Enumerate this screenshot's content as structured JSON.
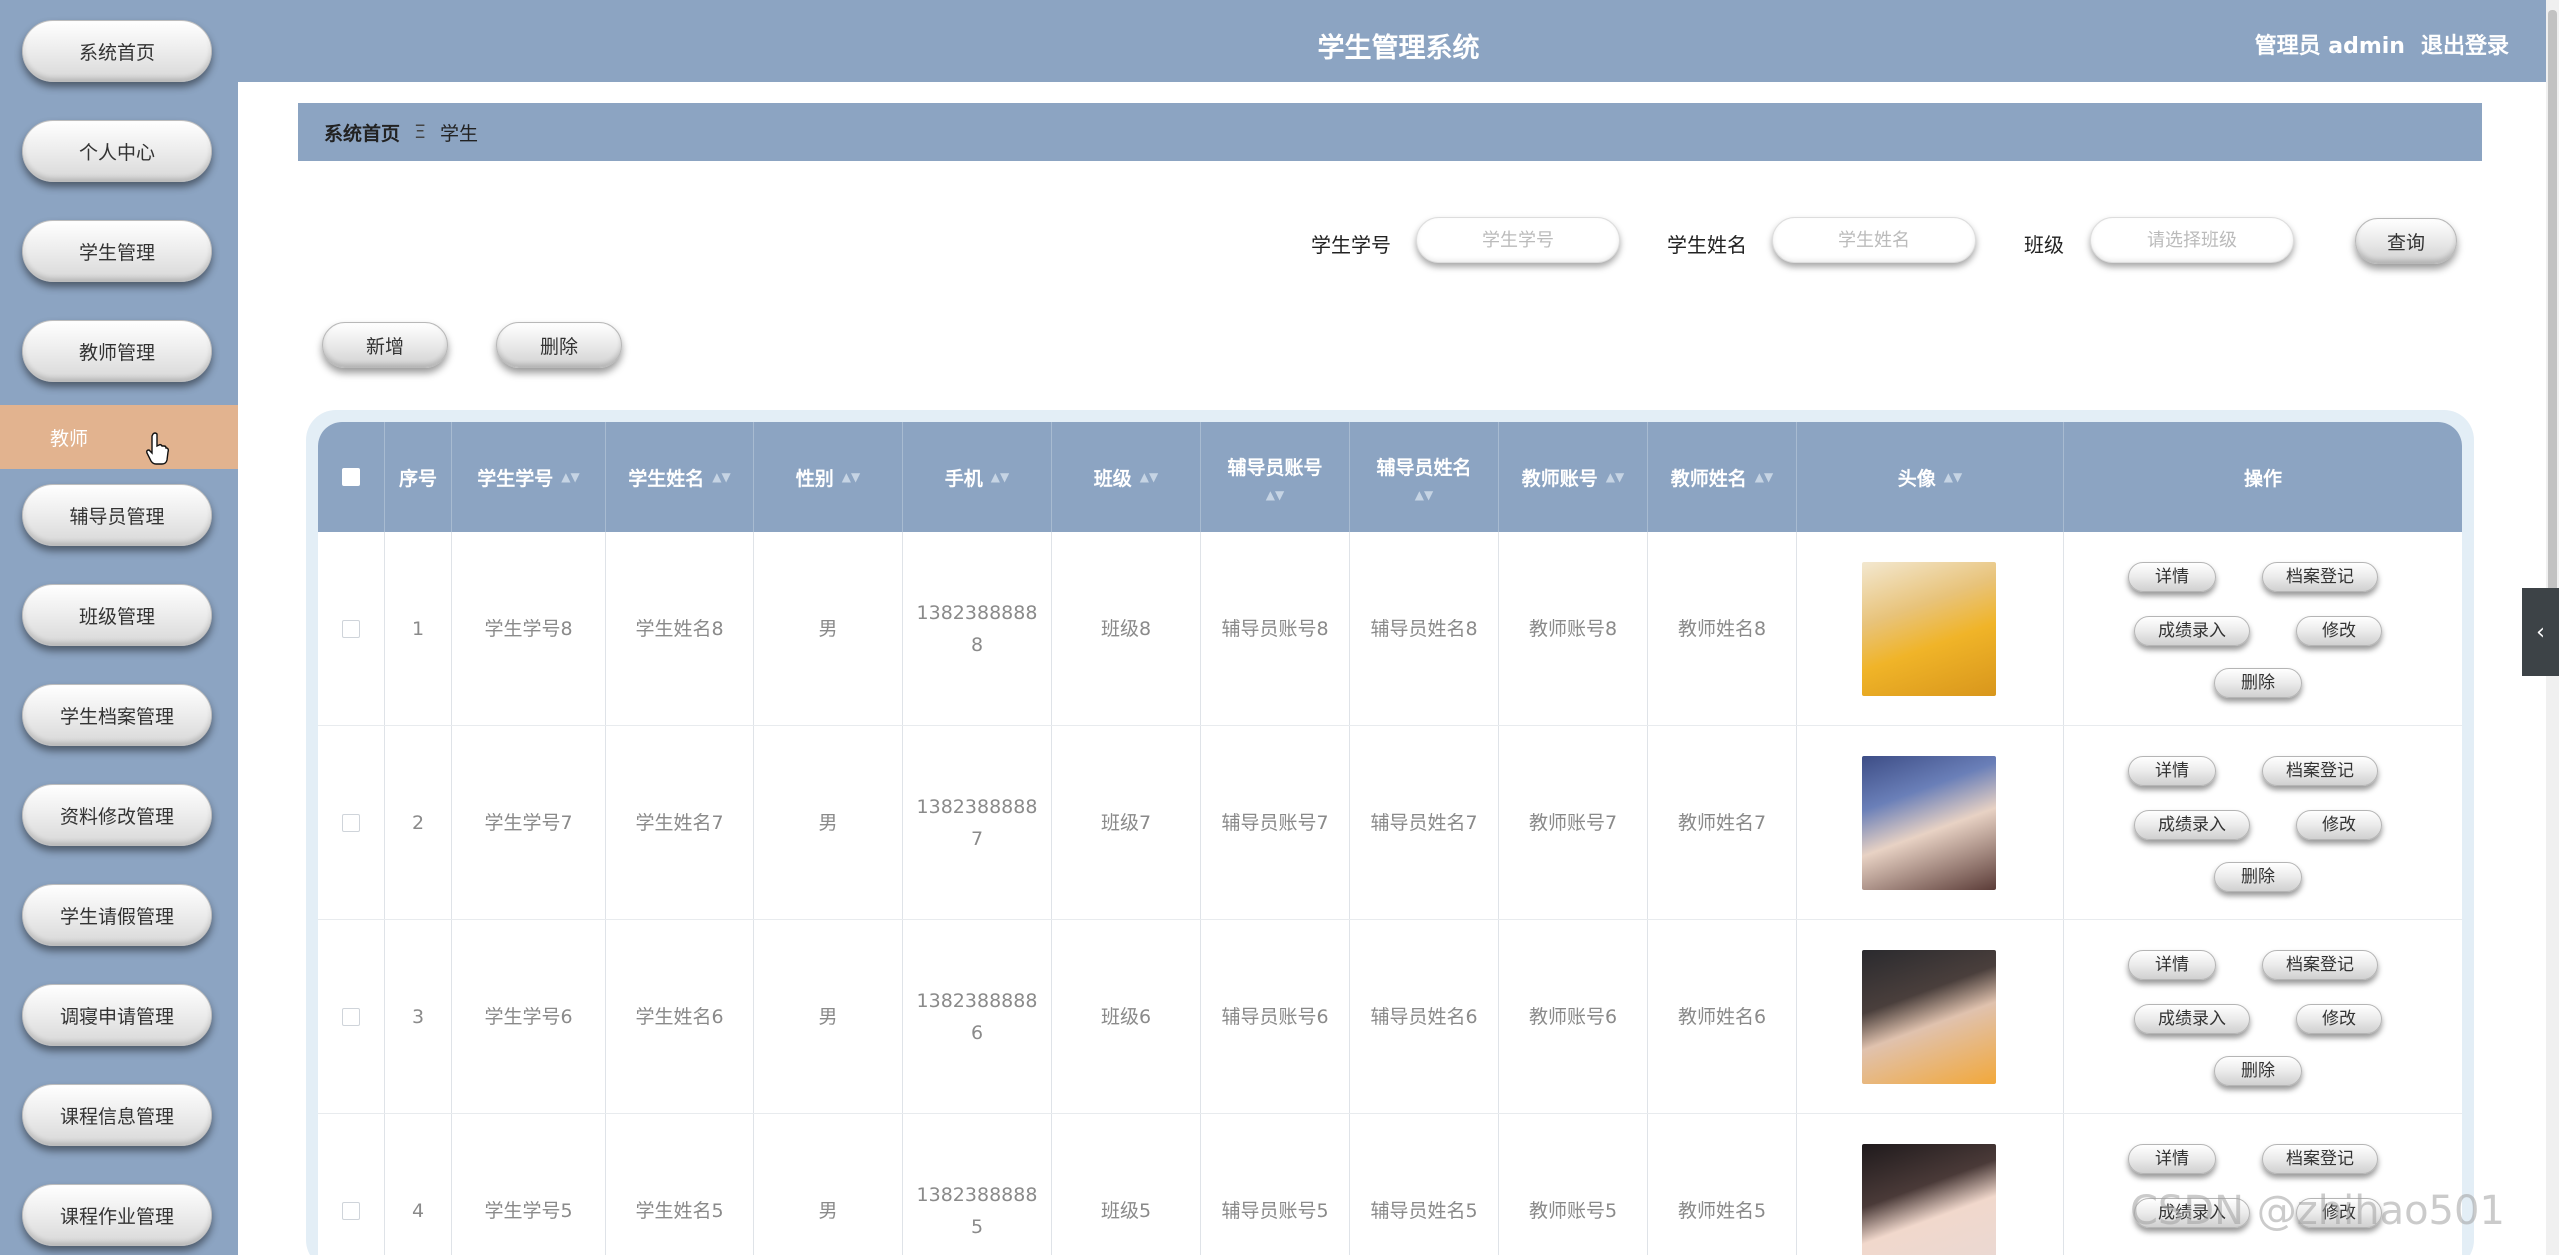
{
  "header": {
    "title": "学生管理系统",
    "user": "管理员 admin",
    "logout": "退出登录"
  },
  "sidebar": {
    "items": [
      "系统首页",
      "个人中心",
      "学生管理",
      "教师管理",
      "辅导员管理",
      "班级管理",
      "学生档案管理",
      "资料修改管理",
      "学生请假管理",
      "调寝申请管理",
      "课程信息管理",
      "课程作业管理"
    ],
    "active_sub": "教师"
  },
  "breadcrumb": {
    "home": "系统首页",
    "separator": "Ξ",
    "current": "学生"
  },
  "search": {
    "student_no_label": "学生学号",
    "student_no_placeholder": "学生学号",
    "student_name_label": "学生姓名",
    "student_name_placeholder": "学生姓名",
    "class_label": "班级",
    "class_placeholder": "请选择班级",
    "query_button": "查询"
  },
  "actions": {
    "add": "新增",
    "delete": "删除"
  },
  "table": {
    "headers": {
      "index": "序号",
      "student_no": "学生学号",
      "student_name": "学生姓名",
      "gender": "性别",
      "phone": "手机",
      "class": "班级",
      "counselor_account": "辅导员账号",
      "counselor_name": "辅导员姓名",
      "teacher_account": "教师账号",
      "teacher_name": "教师姓名",
      "avatar": "头像",
      "operations": "操作"
    },
    "op_labels": {
      "detail": "详情",
      "archive": "档案登记",
      "grade": "成绩录入",
      "edit": "修改",
      "delete": "删除"
    },
    "rows": [
      {
        "index": "1",
        "student_no": "学生学号8",
        "student_name": "学生姓名8",
        "gender": "男",
        "phone_a": "1382388888",
        "phone_b": "8",
        "class": "班级8",
        "counselor_account": "辅导员账号8",
        "counselor_name": "辅导员姓名8",
        "teacher_account": "教师账号8",
        "teacher_name": "教师姓名8"
      },
      {
        "index": "2",
        "student_no": "学生学号7",
        "student_name": "学生姓名7",
        "gender": "男",
        "phone_a": "1382388888",
        "phone_b": "7",
        "class": "班级7",
        "counselor_account": "辅导员账号7",
        "counselor_name": "辅导员姓名7",
        "teacher_account": "教师账号7",
        "teacher_name": "教师姓名7"
      },
      {
        "index": "3",
        "student_no": "学生学号6",
        "student_name": "学生姓名6",
        "gender": "男",
        "phone_a": "1382388888",
        "phone_b": "6",
        "class": "班级6",
        "counselor_account": "辅导员账号6",
        "counselor_name": "辅导员姓名6",
        "teacher_account": "教师账号6",
        "teacher_name": "教师姓名6"
      },
      {
        "index": "4",
        "student_no": "学生学号5",
        "student_name": "学生姓名5",
        "gender": "男",
        "phone_a": "1382388888",
        "phone_b": "5",
        "class": "班级5",
        "counselor_account": "辅导员账号5",
        "counselor_name": "辅导员姓名5",
        "teacher_account": "教师账号5",
        "teacher_name": "教师姓名5"
      }
    ]
  },
  "watermark": "CSDN @zhihao501",
  "colors": {
    "primary": "#8ca4c2",
    "active_sub": "#e2b38f",
    "table_frame": "#e3eef6"
  }
}
